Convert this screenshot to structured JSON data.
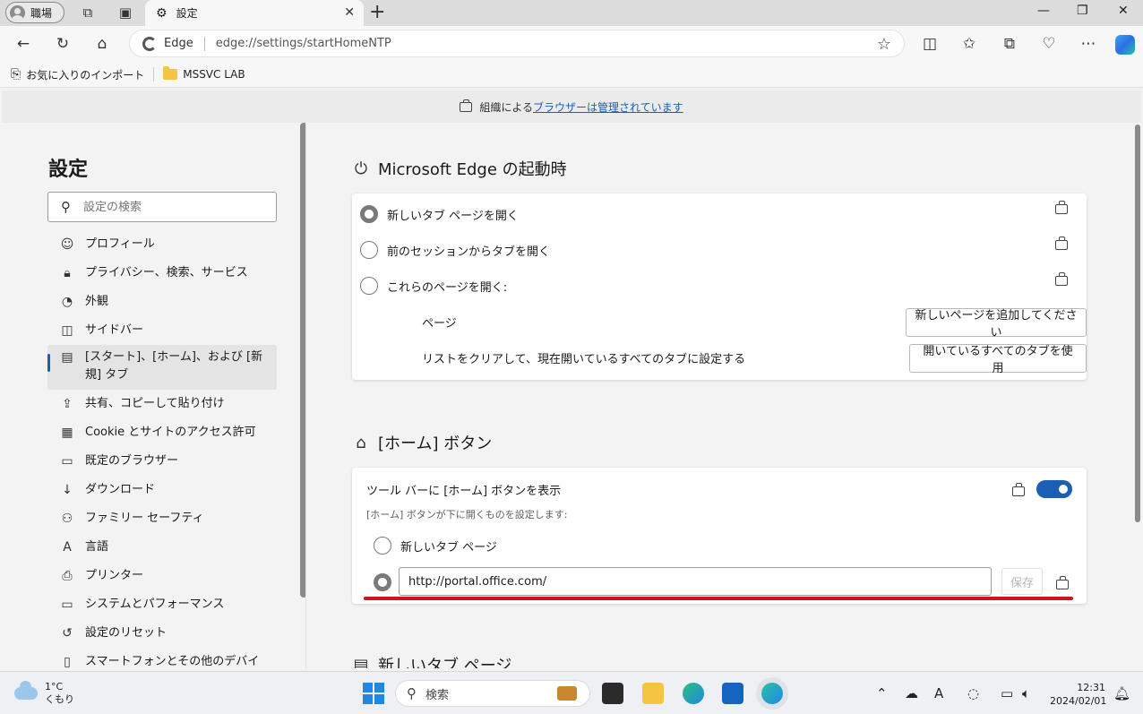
{
  "titlebar": {
    "profile_label": "職場",
    "tab_title": "設定",
    "tab_close": "✕",
    "new_tab": "+",
    "minimize": "—",
    "restore": "❐",
    "close": "✕"
  },
  "navbar": {
    "site_label": "Edge",
    "url": "edge://settings/startHomeNTP"
  },
  "favorites": {
    "import_label": "お気に入りのインポート",
    "folder_label": "MSSVC LAB"
  },
  "banner": {
    "prefix": "組織による",
    "link": "ブラウザーは管理されています"
  },
  "sidebar": {
    "title": "設定",
    "search_placeholder": "設定の検索",
    "items": [
      {
        "label": "プロフィール",
        "icon": "profile-icon"
      },
      {
        "label": "プライバシー、検索、サービス",
        "icon": "lock-icon"
      },
      {
        "label": "外観",
        "icon": "palette-icon"
      },
      {
        "label": "サイドバー",
        "icon": "sidebar-icon"
      },
      {
        "label": "[スタート]、[ホーム]、および [新規] タブ",
        "icon": "home-tabs-icon"
      },
      {
        "label": "共有、コピーして貼り付け",
        "icon": "share-icon"
      },
      {
        "label": "Cookie とサイトのアクセス許可",
        "icon": "cookie-icon"
      },
      {
        "label": "既定のブラウザー",
        "icon": "browser-icon"
      },
      {
        "label": "ダウンロード",
        "icon": "download-icon"
      },
      {
        "label": "ファミリー セーフティ",
        "icon": "family-icon"
      },
      {
        "label": "言語",
        "icon": "language-icon"
      },
      {
        "label": "プリンター",
        "icon": "printer-icon"
      },
      {
        "label": "システムとパフォーマンス",
        "icon": "system-icon"
      },
      {
        "label": "設定のリセット",
        "icon": "reset-icon"
      },
      {
        "label": "スマートフォンとその他のデバイス",
        "icon": "phone-icon"
      }
    ]
  },
  "startup": {
    "title": "Microsoft Edge の起動時",
    "options": [
      {
        "label": "新しいタブ ページを開く",
        "selected": true
      },
      {
        "label": "前のセッションからタブを開く",
        "selected": false
      },
      {
        "label": "これらのページを開く:",
        "selected": false
      }
    ],
    "pages_label": "ページ",
    "add_page_button": "新しいページを追加してください",
    "clear_label": "リストをクリアして、現在開いているすべてのタブに設定する",
    "use_all_tabs_button": "開いているすべてのタブを使用"
  },
  "home": {
    "title": "[ホーム] ボタン",
    "show_label": "ツール バーに [ホーム] ボタンを表示",
    "description": "[ホーム] ボタンが下に開くものを設定します:",
    "toggle_on": true,
    "option_newtab": "新しいタブ ページ",
    "url_value": "http://portal.office.com/",
    "save_button": "保存"
  },
  "newtab": {
    "title": "新しいタブ ページ"
  },
  "taskbar": {
    "temperature": "1°C",
    "weather": "くもり",
    "search_label": "検索",
    "time": "12:31",
    "date": "2024/02/01"
  }
}
